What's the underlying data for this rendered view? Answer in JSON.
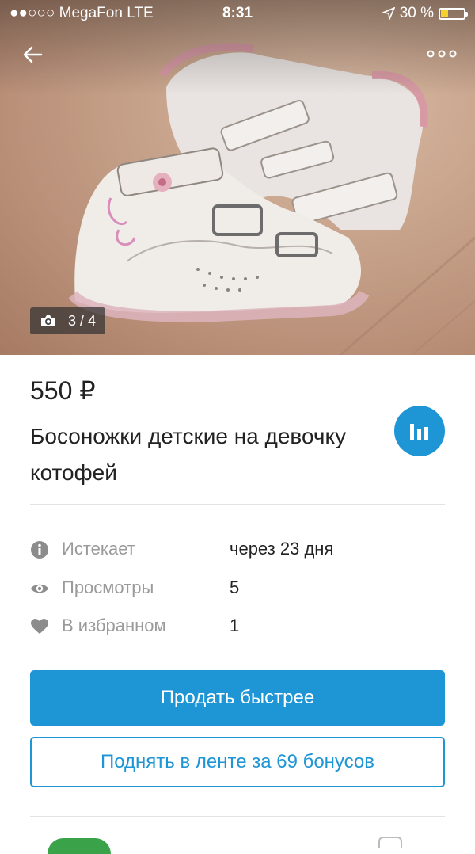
{
  "status_bar": {
    "carrier": "●●○○○ MegaFon  LTE",
    "time": "8:31",
    "battery": "30 %"
  },
  "gallery": {
    "counter": "3 / 4"
  },
  "listing": {
    "price": "550 ₽",
    "title": "Босоножки детские на девочку котофей"
  },
  "info": [
    {
      "icon": "info-icon",
      "label": "Истекает",
      "value": "через 23 дня"
    },
    {
      "icon": "eye-icon",
      "label": "Просмотры",
      "value": "5"
    },
    {
      "icon": "heart-icon",
      "label": "В избранном",
      "value": "1"
    }
  ],
  "actions": {
    "sell_faster": "Продать быстрее",
    "boost": "Поднять в ленте за 69 бонусов"
  },
  "colors": {
    "accent": "#1e95d4"
  }
}
